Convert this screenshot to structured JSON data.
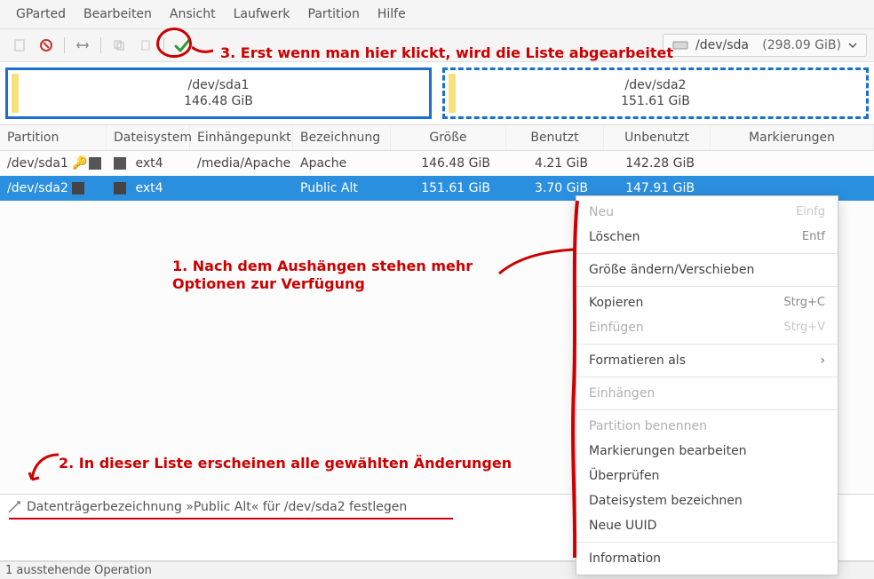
{
  "menubar": {
    "items": [
      "GParted",
      "Bearbeiten",
      "Ansicht",
      "Laufwerk",
      "Partition",
      "Hilfe"
    ]
  },
  "toolbar": {
    "device_name": "/dev/sda",
    "device_size": "(298.09 GiB)"
  },
  "partmap": [
    {
      "name": "/dev/sda1",
      "size": "146.48 GiB"
    },
    {
      "name": "/dev/sda2",
      "size": "151.61 GiB"
    }
  ],
  "columns": {
    "partition": "Partition",
    "filesystem": "Dateisystem",
    "mountpoint": "Einhängepunkt",
    "label": "Bezeichnung",
    "size": "Größe",
    "used": "Benutzt",
    "unused": "Unbenutzt",
    "flags": "Markierungen"
  },
  "rows": [
    {
      "partition": "/dev/sda1",
      "locked": true,
      "filesystem": "ext4",
      "mountpoint": "/media/Apache",
      "label": "Apache",
      "size": "146.48 GiB",
      "used": "4.21 GiB",
      "unused": "142.28 GiB",
      "flags": "",
      "selected": false
    },
    {
      "partition": "/dev/sda2",
      "locked": false,
      "filesystem": "ext4",
      "mountpoint": "",
      "label": "Public Alt",
      "size": "151.61 GiB",
      "used": "3.70 GiB",
      "unused": "147.91 GiB",
      "flags": "",
      "selected": true
    }
  ],
  "context_menu": [
    {
      "label": "Neu",
      "accel": "Einfg",
      "disabled": true
    },
    {
      "label": "Löschen",
      "accel": "Entf",
      "disabled": false
    },
    {
      "sep": true
    },
    {
      "label": "Größe ändern/Verschieben",
      "disabled": false
    },
    {
      "sep": true
    },
    {
      "label": "Kopieren",
      "accel": "Strg+C",
      "disabled": false
    },
    {
      "label": "Einfügen",
      "accel": "Strg+V",
      "disabled": true
    },
    {
      "sep": true
    },
    {
      "label": "Formatieren als",
      "submenu": true,
      "disabled": false
    },
    {
      "sep": true
    },
    {
      "label": "Einhängen",
      "disabled": true
    },
    {
      "sep": true
    },
    {
      "label": "Partition benennen",
      "disabled": true
    },
    {
      "label": "Markierungen bearbeiten",
      "disabled": false
    },
    {
      "label": "Überprüfen",
      "disabled": false
    },
    {
      "label": "Dateisystem bezeichnen",
      "disabled": false
    },
    {
      "label": "Neue UUID",
      "disabled": false
    },
    {
      "sep": true
    },
    {
      "label": "Information",
      "disabled": false
    }
  ],
  "pending": {
    "line": "Datenträgerbezeichnung »Public Alt« für /dev/sda2 festlegen"
  },
  "statusbar": "1 ausstehende Operation",
  "annotations": {
    "a1": "1. Nach dem Aushängen stehen mehr Optionen zur Verfügung",
    "a2": "2. In dieser Liste erscheinen alle gewählten Änderungen",
    "a3": "3. Erst wenn man hier klickt, wird die Liste abgearbeitet"
  }
}
